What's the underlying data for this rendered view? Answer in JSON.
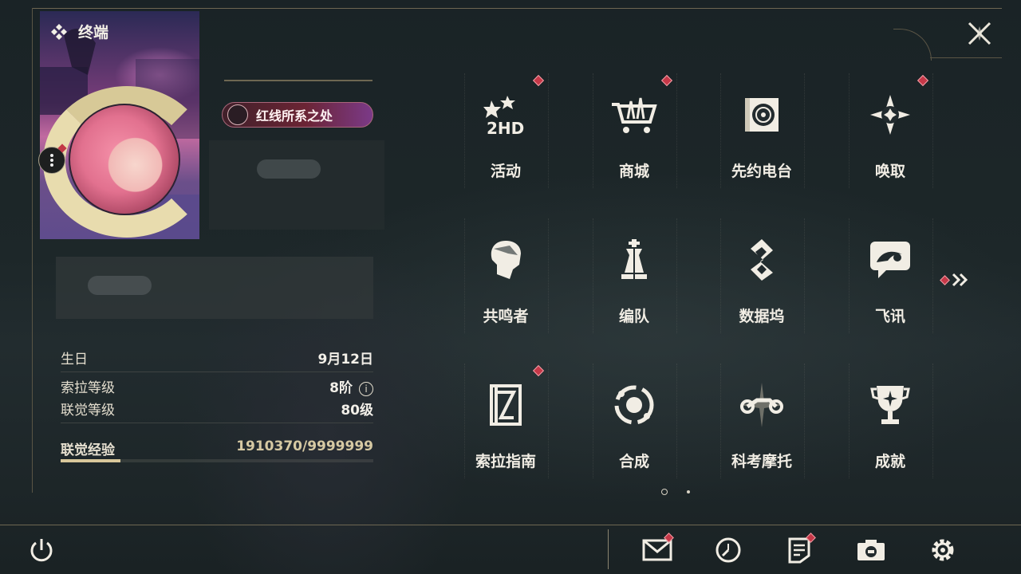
{
  "header": {
    "title": "终端",
    "title_icon": "diamond-cluster-icon",
    "close_icon": "close-x-icon"
  },
  "profile": {
    "title_badge": "红线所系之处",
    "stats": [
      {
        "label": "生日",
        "value": "9月12日"
      },
      {
        "label": "索拉等级",
        "value": "8阶",
        "info": "i"
      },
      {
        "label": "联觉等级",
        "value": "80级"
      }
    ],
    "exp": {
      "label": "联觉经验",
      "value": "1910370/9999999",
      "progress": 0.191
    }
  },
  "menu": {
    "tiles": [
      {
        "label": "活动",
        "icon": "event-2hd-icon",
        "badge": true
      },
      {
        "label": "商城",
        "icon": "shop-cart-icon",
        "badge": true
      },
      {
        "label": "先约电台",
        "icon": "radio-icon",
        "badge": false
      },
      {
        "label": "唤取",
        "icon": "convene-star-icon",
        "badge": true
      },
      {
        "label": "共鸣者",
        "icon": "resonator-head-icon",
        "badge": false
      },
      {
        "label": "编队",
        "icon": "chess-team-icon",
        "badge": false
      },
      {
        "label": "数据坞",
        "icon": "data-bank-icon",
        "badge": false
      },
      {
        "label": "飞讯",
        "icon": "chat-icon",
        "badge": false
      },
      {
        "label": "索拉指南",
        "icon": "guidebook-icon",
        "badge": true
      },
      {
        "label": "合成",
        "icon": "synthesis-icon",
        "badge": false
      },
      {
        "label": "科考摩托",
        "icon": "motorcycle-icon",
        "badge": false
      },
      {
        "label": "成就",
        "icon": "trophy-icon",
        "badge": false
      }
    ],
    "page_indicator": {
      "current": 1,
      "total": 2
    }
  },
  "bottom_bar": {
    "items": [
      {
        "name": "power",
        "icon": "power-icon",
        "badge": false
      },
      {
        "name": "mail",
        "icon": "mail-icon",
        "badge": true
      },
      {
        "name": "timer",
        "icon": "clock-icon",
        "badge": false
      },
      {
        "name": "notice",
        "icon": "notice-icon",
        "badge": true
      },
      {
        "name": "camera",
        "icon": "camera-icon",
        "badge": false
      },
      {
        "name": "settings",
        "icon": "gear-icon",
        "badge": false
      }
    ]
  },
  "colors": {
    "accent": "#d8c79a",
    "badge_red": "#c63848",
    "text": "#f1ede4"
  }
}
